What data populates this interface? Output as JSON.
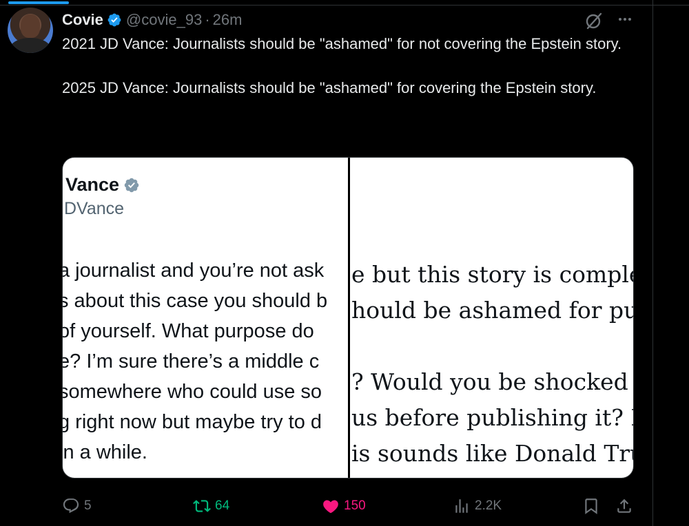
{
  "post": {
    "author_name": "Covie",
    "handle": "@covie_93",
    "separator": "·",
    "time": "26m",
    "text_lines": [
      "2021 JD Vance: Journalists should be \"ashamed\" for not covering the Epstein story.",
      "2025 JD Vance: Journalists should be \"ashamed\" for covering the Epstein story."
    ]
  },
  "media": {
    "left": {
      "name": "Vance",
      "handle": "DVance",
      "lines": [
        "a journalist and you’re not ask",
        "s about this case you should b",
        " of yourself. What purpose do",
        "e? I’m sure there’s a middle c",
        "somewhere who could use so",
        "g right now but maybe try to d",
        "in a while."
      ]
    },
    "right": {
      "lines": [
        "e but this story is comple",
        "hould be ashamed for pu",
        "",
        "? Would you be shocked",
        "us before publishing it? D",
        "is sounds like Donald Tru"
      ]
    }
  },
  "actions": {
    "replies": "5",
    "retweets": "64",
    "likes": "150",
    "views": "2.2K"
  },
  "colors": {
    "accent": "#1d9bf0",
    "retweet": "#00ba7c",
    "like": "#f91880",
    "muted": "#71767b"
  },
  "icons": [
    "verified-badge-icon",
    "grok-icon",
    "more-icon",
    "reply-icon",
    "retweet-icon",
    "like-icon",
    "views-icon",
    "bookmark-icon",
    "share-icon"
  ]
}
